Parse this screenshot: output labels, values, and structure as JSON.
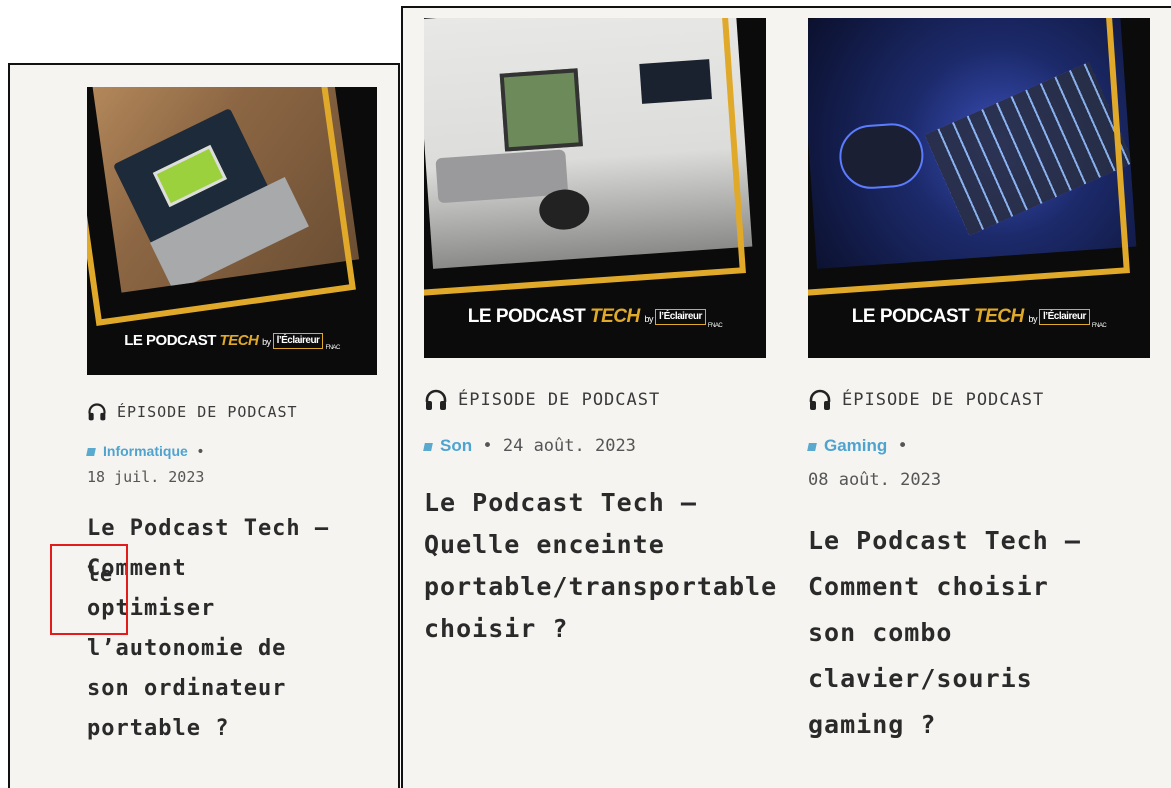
{
  "cards": [
    {
      "type_label": "ÉPISODE DE PODCAST",
      "category": "Informatique",
      "separator": "•",
      "date": "18 juil. 2023",
      "title_lines": [
        "Le Podcast Tech –",
        "Comment",
        "optimiser",
        "l’autonomie de",
        "son ordinateur",
        "portable ?"
      ],
      "overlap_text": "le",
      "thumb": {
        "brand_left": "LE PODCAST ",
        "brand_accent": "TECH",
        "brand_by": "by",
        "brand_logo": "l’Éclaireur",
        "brand_logo_sub": "FNAC",
        "photo": "laptop battery"
      }
    },
    {
      "type_label": "ÉPISODE DE PODCAST",
      "category": "Son",
      "separator": "•",
      "date": "24 août. 2023",
      "title_lines": [
        "Le Podcast Tech –",
        "Quelle enceinte",
        "portable/transportable",
        "choisir ?"
      ],
      "thumb": {
        "brand_left": "LE PODCAST ",
        "brand_accent": "TECH",
        "brand_by": "by",
        "brand_logo": "l’Éclaireur",
        "brand_logo_sub": "FNAC",
        "photo": "living room"
      }
    },
    {
      "type_label": "ÉPISODE DE PODCAST",
      "category": "Gaming",
      "separator": "•",
      "date": "08 août. 2023",
      "title_lines": [
        "Le Podcast Tech –",
        "Comment choisir",
        "son combo",
        "clavier/souris",
        "gaming ?"
      ],
      "thumb": {
        "brand_left": "LE PODCAST ",
        "brand_accent": "TECH",
        "brand_by": "by",
        "brand_logo": "l’Éclaireur",
        "brand_logo_sub": "FNAC",
        "photo": "keyboard mouse"
      }
    }
  ],
  "colors": {
    "accent_gold": "#e0a92a",
    "category_blue": "#4fa3cf",
    "highlight_red": "#e21b1b",
    "panel_bg": "#f5f4f1"
  }
}
